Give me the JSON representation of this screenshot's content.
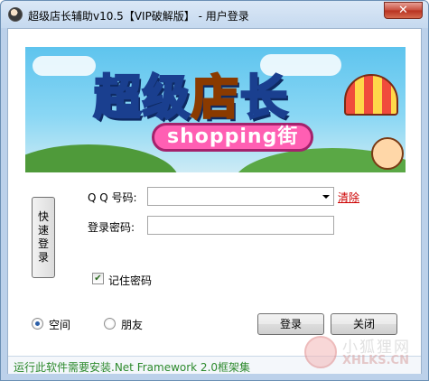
{
  "window": {
    "title": "超级店长辅助v10.5【VIP破解版】 - 用户登录",
    "close_glyph": "✕"
  },
  "banner": {
    "title_part1": "超级",
    "title_part2": "店",
    "title_part3": "长",
    "subtitle": "shopping街"
  },
  "form": {
    "quick_login_label": "快速登录",
    "qq_label": "Q Q 号码:",
    "qq_value": "",
    "clear_link": "清除",
    "password_label": "登录密码:",
    "password_value": "",
    "remember_label": "记住密码",
    "remember_checked": true
  },
  "options": {
    "radio1_label": "空间",
    "radio2_label": "朋友",
    "selected": "空间"
  },
  "buttons": {
    "login": "登录",
    "close": "关闭"
  },
  "status": {
    "text": "运行此软件需要安装.Net Framework 2.0框架集"
  },
  "watermark": {
    "cn": "小狐狸网",
    "en": "XHLKS.CN"
  },
  "colors": {
    "title_bar": "#c5d9ef",
    "close_button": "#c74c3c",
    "clear_link": "#cc0000",
    "status_text": "#2d8a2d"
  }
}
